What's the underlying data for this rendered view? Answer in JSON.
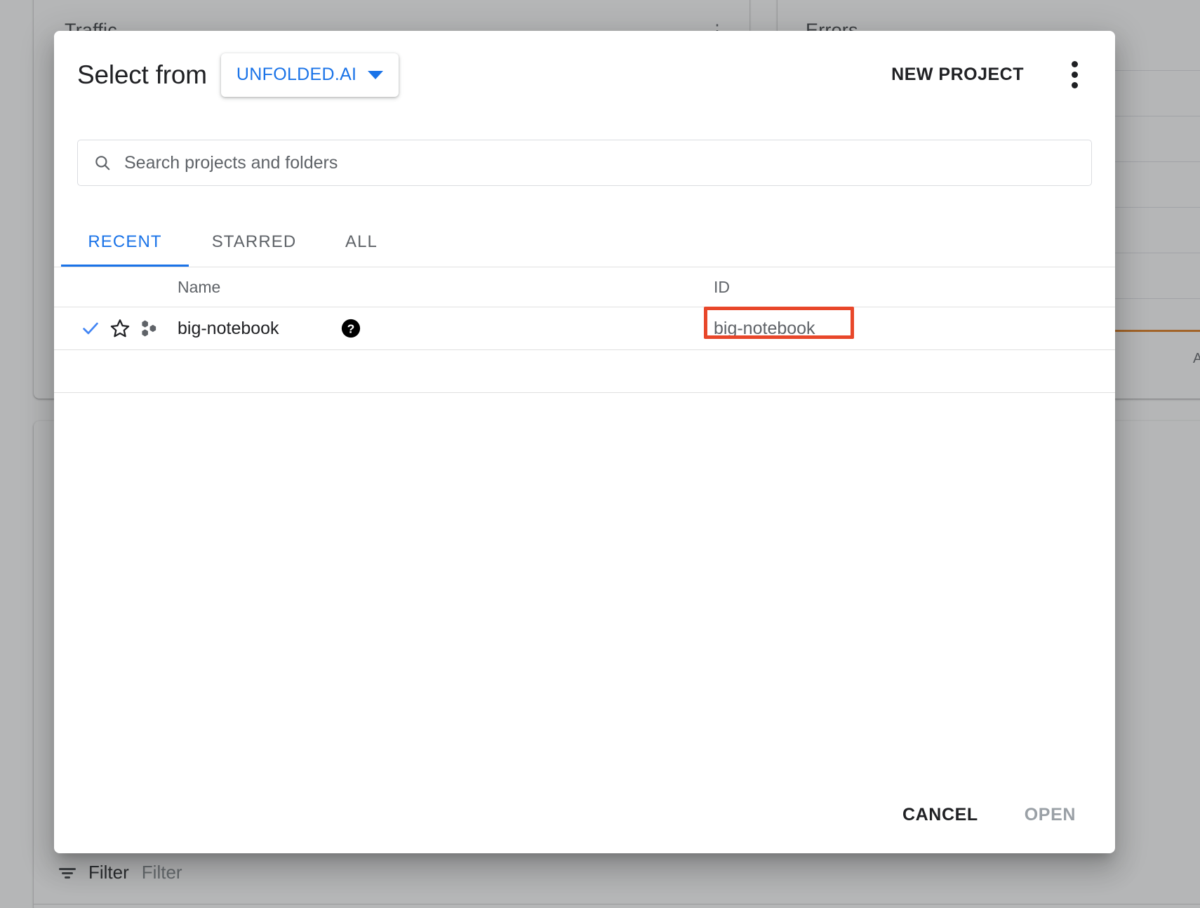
{
  "background": {
    "card_left_title": "Traffic",
    "card_right_title": "Errors",
    "card_left_menu_icon": "more-vert-icon",
    "chart_axis_label": "A",
    "filter": {
      "icon": "filter-list-icon",
      "label": "Filter",
      "placeholder": "Filter"
    }
  },
  "dialog": {
    "title": "Select from",
    "org_selector": {
      "label": "UNFOLDED.AI",
      "caret_icon": "chevron-down-icon"
    },
    "new_project_label": "NEW PROJECT",
    "overflow_icon": "more-vert-icon",
    "search": {
      "icon": "search-icon",
      "value": "",
      "placeholder": "Search projects and folders"
    },
    "tabs": [
      {
        "label": "RECENT",
        "active": true
      },
      {
        "label": "STARRED",
        "active": false
      },
      {
        "label": "ALL",
        "active": false
      }
    ],
    "table": {
      "columns": [
        "Name",
        "ID"
      ],
      "rows": [
        {
          "selected_icon": "check-icon",
          "star_icon": "star-outline-icon",
          "type_icon": "project-hexagons-icon",
          "name": "big-notebook",
          "help_icon": "help-filled-icon",
          "id": "big-notebook"
        }
      ]
    },
    "footer": {
      "cancel_label": "CANCEL",
      "open_label": "OPEN"
    }
  },
  "annotation": {
    "target": "big-notebook",
    "color": "#E8472A"
  },
  "colors": {
    "accent_blue": "#1a73e8",
    "text_primary": "#202124",
    "text_secondary": "#5f6368",
    "divider": "#e0e0e0",
    "highlight_red": "#E8472A",
    "chart_orange": "#e07b1a"
  }
}
